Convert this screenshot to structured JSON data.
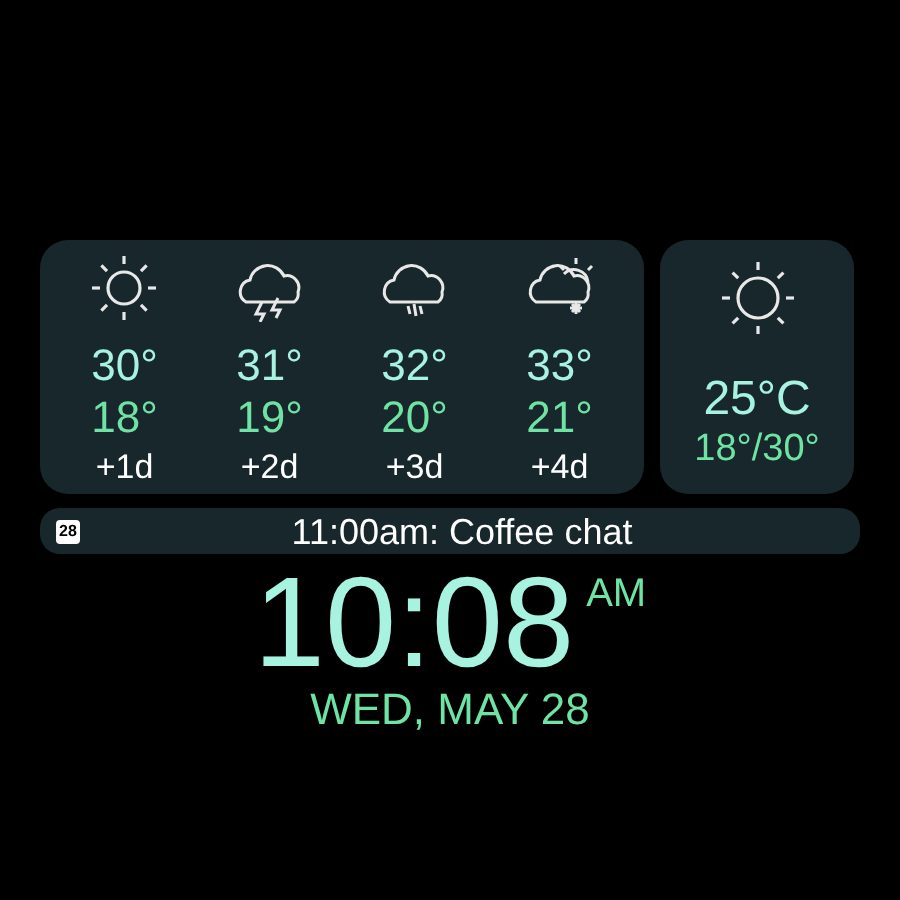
{
  "forecast": [
    {
      "kind": "sun",
      "high": "30°",
      "low": "18°",
      "day": "+1d"
    },
    {
      "kind": "storm",
      "high": "31°",
      "low": "19°",
      "day": "+2d"
    },
    {
      "kind": "rain",
      "high": "32°",
      "low": "20°",
      "day": "+3d"
    },
    {
      "kind": "snow",
      "high": "33°",
      "low": "21°",
      "day": "+4d"
    }
  ],
  "current": {
    "kind": "sun",
    "temperature": "25°C",
    "range": "18°/30°"
  },
  "event": {
    "calendar_day": "28",
    "text": "11:00am: Coffee chat"
  },
  "clock": {
    "time": "10:08",
    "period": "AM",
    "date": "WED, MAY 28"
  }
}
